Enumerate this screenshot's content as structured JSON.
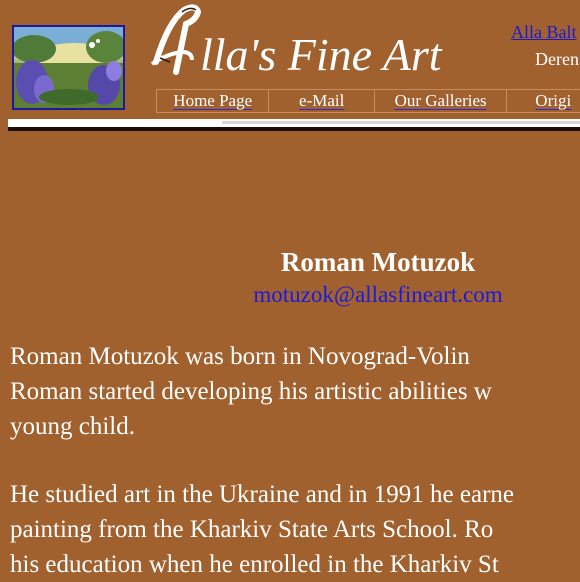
{
  "header": {
    "site_title": "lla's Fine Art",
    "logo_letter": "A",
    "top_link": "Alla Balt",
    "top_subtext": "Deren"
  },
  "nav": {
    "items": [
      {
        "label": "Home Page"
      },
      {
        "label": "e-Mail"
      },
      {
        "label": "Our Galleries"
      },
      {
        "label": "Origi"
      }
    ]
  },
  "artist": {
    "name": "Roman Motuzok",
    "email": "motuzok@allasfineart.com"
  },
  "bio": {
    "paragraph1": [
      "Roman  Motuzok  was  born  in  Novograd-Volin",
      "Roman  started  developing  his  artistic  abilities  w",
      "young child."
    ],
    "paragraph2": [
      "He studied art in the Ukraine and in 1991 he earne",
      "painting from the Kharkiv State Arts School.  Ro",
      "his education when he enrolled in the Kharkiv St"
    ]
  },
  "colors": {
    "background": "#a0612e",
    "link": "#1a1ae0",
    "text": "#ffffff"
  }
}
